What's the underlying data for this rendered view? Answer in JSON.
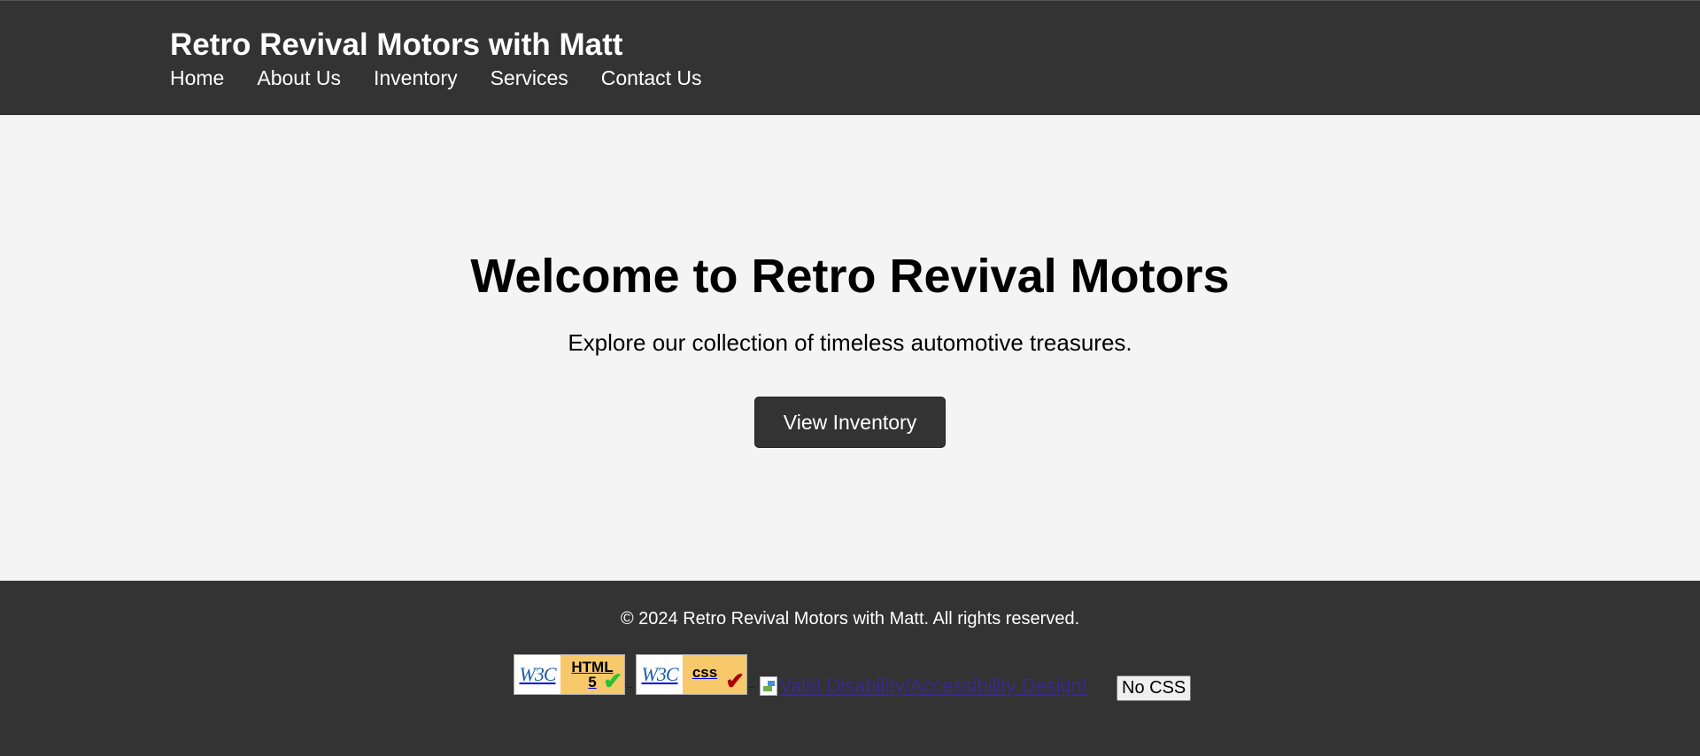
{
  "header": {
    "site_title": "Retro Revival Motors with Matt",
    "nav": [
      {
        "label": "Home"
      },
      {
        "label": "About Us"
      },
      {
        "label": "Inventory"
      },
      {
        "label": "Services"
      },
      {
        "label": "Contact Us"
      }
    ]
  },
  "hero": {
    "heading": "Welcome to Retro Revival Motors",
    "subheading": "Explore our collection of timeless automotive treasures.",
    "cta_label": "View Inventory"
  },
  "footer": {
    "copyright": "© 2024 Retro Revival Motors with Matt. All rights reserved.",
    "badges": {
      "html_badge": {
        "w3c": "W3C",
        "tech_line1": "HTML",
        "tech_line2": "5",
        "check_color": "#2ec02e"
      },
      "css_badge": {
        "w3c": "W3C",
        "tech_line1": "css",
        "check_color": "#a80000"
      },
      "accessibility_alt": "Valid Disability/Accessibility Design!"
    },
    "nocss_label": "No CSS"
  },
  "colors": {
    "header_bg": "#333333",
    "page_bg": "#f4f4f4",
    "button_bg": "#333333",
    "text_light": "#ffffff"
  }
}
